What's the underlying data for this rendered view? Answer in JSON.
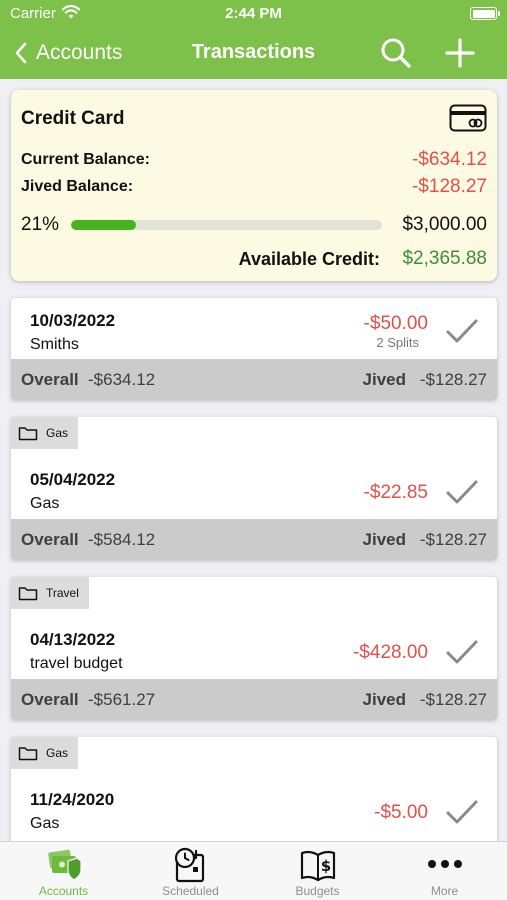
{
  "status_bar": {
    "carrier": "Carrier",
    "time": "2:44 PM"
  },
  "nav": {
    "back_label": "Accounts",
    "title": "Transactions",
    "search_icon": "search-icon",
    "add_icon": "plus-icon"
  },
  "colors": {
    "nav_green": "#7dc04a",
    "negative_red": "#e2504a",
    "positive_green": "#3e8d37",
    "progress_green": "#46b41f"
  },
  "account": {
    "name": "Credit Card",
    "current_balance_label": "Current Balance:",
    "current_balance": "-$634.12",
    "jived_balance_label": "Jived Balance:",
    "jived_balance": "-$128.27",
    "utilization_text": "21%",
    "utilization": 0.21,
    "credit_limit": "$3,000.00",
    "available_label": "Available Credit:",
    "available_value": "$2,365.88"
  },
  "transactions": [
    {
      "category": "",
      "date": "10/03/2022",
      "payee": "Smiths",
      "amount": "-$50.00",
      "splits": "2 Splits",
      "overall_label": "Overall",
      "overall": "-$634.12",
      "jived_label": "Jived",
      "jived": "-$128.27"
    },
    {
      "category": "Gas",
      "date": "05/04/2022",
      "payee": "Gas",
      "amount": "-$22.85",
      "overall_label": "Overall",
      "overall": "-$584.12",
      "jived_label": "Jived",
      "jived": "-$128.27"
    },
    {
      "category": "Travel",
      "date": "04/13/2022",
      "payee": "travel budget",
      "amount": "-$428.00",
      "overall_label": "Overall",
      "overall": "-$561.27",
      "jived_label": "Jived",
      "jived": "-$128.27"
    },
    {
      "category": "Gas",
      "date": "11/24/2020",
      "payee": "Gas",
      "amount": "-$5.00"
    }
  ],
  "tabs": [
    {
      "label": "Accounts",
      "icon": "accounts-icon",
      "active": true
    },
    {
      "label": "Scheduled",
      "icon": "scheduled-icon",
      "active": false
    },
    {
      "label": "Budgets",
      "icon": "budgets-icon",
      "active": false
    },
    {
      "label": "More",
      "icon": "more-icon",
      "active": false
    }
  ]
}
